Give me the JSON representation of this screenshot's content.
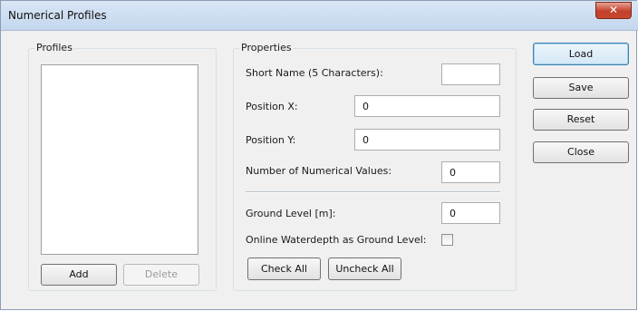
{
  "window": {
    "title": "Numerical Profiles",
    "close_glyph": "✕"
  },
  "profiles": {
    "group_label": "Profiles",
    "items": [],
    "add_label": "Add",
    "delete_label": "Delete"
  },
  "properties": {
    "group_label": "Properties",
    "short_name": {
      "label": "Short Name (5 Characters):",
      "value": ""
    },
    "position_x": {
      "label": "Position X:",
      "value": "0"
    },
    "position_y": {
      "label": "Position Y:",
      "value": "0"
    },
    "numerical_values": {
      "label": "Number of Numerical Values:",
      "value": "0"
    },
    "ground_level": {
      "label": "Ground Level [m]:",
      "value": "0"
    },
    "waterdepth": {
      "label": "Online Waterdepth as Ground Level:",
      "checked": false
    },
    "check_all_label": "Check All",
    "uncheck_all_label": "Uncheck All"
  },
  "actions": {
    "load_label": "Load",
    "save_label": "Save",
    "reset_label": "Reset",
    "close_label": "Close"
  }
}
